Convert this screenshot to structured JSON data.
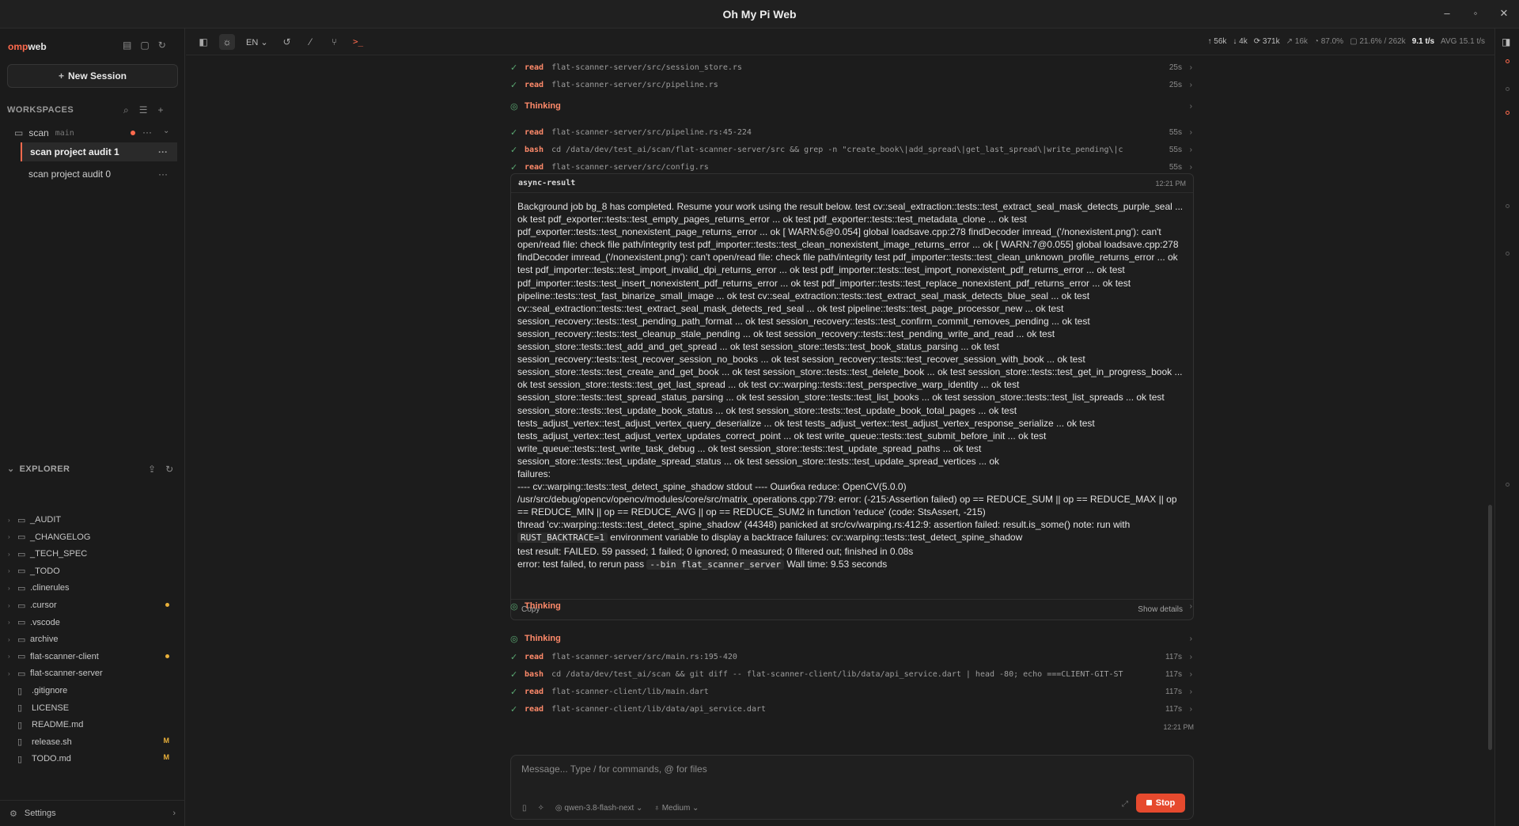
{
  "window": {
    "title": "Oh My Pi Web",
    "controls": [
      "–",
      "◦",
      "✕"
    ]
  },
  "sidebar": {
    "brand_prefix": "omp",
    "brand_suffix": "web",
    "new_session": "New Session",
    "workspaces_label": "WORKSPACES",
    "workspace": {
      "name": "scan",
      "branch": "main"
    },
    "sessions": [
      {
        "label": "scan project audit 1",
        "active": true
      },
      {
        "label": "scan project audit 0",
        "active": false
      }
    ],
    "explorer_label": "EXPLORER",
    "tree": [
      {
        "name": "_AUDIT",
        "type": "folder",
        "mark": ""
      },
      {
        "name": "_CHANGELOG",
        "type": "folder",
        "mark": ""
      },
      {
        "name": "_TECH_SPEC",
        "type": "folder",
        "mark": ""
      },
      {
        "name": "_TODO",
        "type": "folder",
        "mark": ""
      },
      {
        "name": ".clinerules",
        "type": "folder",
        "mark": ""
      },
      {
        "name": ".cursor",
        "type": "folder",
        "mark": "dot"
      },
      {
        "name": ".vscode",
        "type": "folder",
        "mark": ""
      },
      {
        "name": "archive",
        "type": "folder",
        "mark": ""
      },
      {
        "name": "flat-scanner-client",
        "type": "folder",
        "mark": "dot"
      },
      {
        "name": "flat-scanner-server",
        "type": "folder",
        "mark": ""
      },
      {
        "name": ".gitignore",
        "type": "file",
        "mark": ""
      },
      {
        "name": "LICENSE",
        "type": "file",
        "mark": ""
      },
      {
        "name": "README.md",
        "type": "file",
        "mark": ""
      },
      {
        "name": "release.sh",
        "type": "file",
        "mark": "M"
      },
      {
        "name": "TODO.md",
        "type": "file",
        "mark": "M"
      }
    ],
    "settings_label": "Settings"
  },
  "toolbar": {
    "lang": "EN",
    "stats": {
      "up": "56k",
      "down": "4k",
      "cache": "371k",
      "ratio": "16k",
      "cache_pct": "87.0%",
      "context": "21.6% / 262k",
      "speed": "9.1 t/s",
      "avg": "AVG 15.1 t/s"
    }
  },
  "chat": {
    "tools_top": [
      {
        "kind": "tool",
        "verb": "read",
        "arg": "flat-scanner-server/src/session_store.rs",
        "time": "25s"
      },
      {
        "kind": "tool",
        "verb": "read",
        "arg": "flat-scanner-server/src/pipeline.rs",
        "time": "25s"
      },
      {
        "kind": "thinking",
        "label": "Thinking"
      },
      {
        "kind": "tool",
        "verb": "read",
        "arg": "flat-scanner-server/src/pipeline.rs:45-224",
        "time": "55s"
      },
      {
        "kind": "tool",
        "verb": "bash",
        "arg": "cd /data/dev/test_ai/scan/flat-scanner-server/src && grep -n \"create_book\\|add_spread\\|get_last_spread\\|write_pending\\|c",
        "time": "55s"
      },
      {
        "kind": "tool",
        "verb": "read",
        "arg": "flat-scanner-server/src/config.rs",
        "time": "55s"
      }
    ],
    "card": {
      "name": "async-result",
      "time": "12:21 PM",
      "lines": [
        "Background job bg_8 has completed. Resume your work using the result below. test cv::seal_extraction::tests::test_extract_seal_mask_detects_purple_seal ... ok test pdf_exporter::tests::test_empty_pages_returns_error ... ok test pdf_exporter::tests::test_metadata_clone ... ok test pdf_exporter::tests::test_nonexistent_page_returns_error ... ok [ WARN:6@0.054] global loadsave.cpp:278 findDecoder imread_('/nonexistent.png'): can't open/read file: check file path/integrity test pdf_importer::tests::test_clean_nonexistent_image_returns_error ... ok [ WARN:7@0.055] global loadsave.cpp:278 findDecoder imread_('/nonexistent.png'): can't open/read file: check file path/integrity test pdf_importer::tests::test_clean_unknown_profile_returns_error ... ok test pdf_importer::tests::test_import_invalid_dpi_returns_error ... ok test pdf_importer::tests::test_import_nonexistent_pdf_returns_error ... ok test pdf_importer::tests::test_insert_nonexistent_pdf_returns_error ... ok test pdf_importer::tests::test_replace_nonexistent_pdf_returns_error ... ok test pipeline::tests::test_fast_binarize_small_image ... ok test cv::seal_extraction::tests::test_extract_seal_mask_detects_blue_seal ... ok test cv::seal_extraction::tests::test_extract_seal_mask_detects_red_seal ... ok test pipeline::tests::test_page_processor_new ... ok test session_recovery::tests::test_pending_path_format ... ok test session_recovery::tests::test_confirm_commit_removes_pending ... ok test session_recovery::tests::test_cleanup_stale_pending ... ok test session_recovery::tests::test_pending_write_and_read ... ok test session_store::tests::test_add_and_get_spread ... ok test session_store::tests::test_book_status_parsing ... ok test session_recovery::tests::test_recover_session_no_books ... ok test session_recovery::tests::test_recover_session_with_book ... ok test session_store::tests::test_create_and_get_book ... ok test session_store::tests::test_delete_book ... ok test session_store::tests::test_get_in_progress_book ... ok test session_store::tests::test_get_last_spread ... ok test cv::warping::tests::test_perspective_warp_identity ... ok test session_store::tests::test_spread_status_parsing ... ok test session_store::tests::test_list_books ... ok test session_store::tests::test_list_spreads ... ok test session_store::tests::test_update_book_status ... ok test session_store::tests::test_update_book_total_pages ... ok test tests_adjust_vertex::test_adjust_vertex_query_deserialize ... ok test tests_adjust_vertex::test_adjust_vertex_response_serialize ... ok test tests_adjust_vertex::test_adjust_vertex_updates_correct_point ... ok test write_queue::tests::test_submit_before_init ... ok test write_queue::tests::test_write_task_debug ... ok test session_store::tests::test_update_spread_paths ... ok test session_store::tests::test_update_spread_status ... ok test session_store::tests::test_update_spread_vertices ... ok",
        "failures:",
        "---- cv::warping::tests::test_detect_spine_shadow stdout ---- Ошибка reduce: OpenCV(5.0.0) /usr/src/debug/opencv/opencv/modules/core/src/matrix_operations.cpp:779: error: (-215:Assertion failed) op == REDUCE_SUM || op == REDUCE_MAX || op == REDUCE_MIN || op == REDUCE_AVG || op == REDUCE_SUM2 in function 'reduce' (code: StsAssert, -215)",
        "thread 'cv::warping::tests::test_detect_spine_shadow' (44348) panicked at src/cv/warping.rs:412:9: assertion failed: result.is_some() note: run with"
      ],
      "line_env_code": "RUST_BACKTRACE=1",
      "line_env_rest": " environment variable to display a backtrace failures: cv::warping::tests::test_detect_spine_shadow",
      "result_line": "test result: FAILED. 59 passed; 1 failed; 0 ignored; 0 measured; 0 filtered out; finished in 0.08s",
      "err_prefix": "error: test failed, to rerun pass ",
      "err_code": "--bin flat_scanner_server",
      "err_suffix": " Wall time: 9.53 seconds",
      "copy": "Copy",
      "show_details": "Show details"
    },
    "tools_bottom": [
      {
        "kind": "thinking",
        "label": "Thinking"
      },
      {
        "kind": "tool",
        "verb": "read",
        "arg": "flat-scanner-server/src/main.rs:195-420",
        "time": "117s"
      },
      {
        "kind": "tool",
        "verb": "bash",
        "arg": "cd /data/dev/test_ai/scan && git diff -- flat-scanner-client/lib/data/api_service.dart | head -80; echo ===CLIENT-GIT-ST",
        "time": "117s"
      },
      {
        "kind": "tool",
        "verb": "read",
        "arg": "flat-scanner-client/lib/main.dart",
        "time": "117s"
      },
      {
        "kind": "tool",
        "verb": "read",
        "arg": "flat-scanner-client/lib/data/api_service.dart",
        "time": "117s"
      }
    ],
    "stamp": "12:21 PM",
    "thinking_last": "Thinking"
  },
  "composer": {
    "placeholder": "Message... Type / for commands, @ for files",
    "model": "qwen-3.8-flash-next",
    "effort": "Medium",
    "stop": "Stop"
  },
  "colors": {
    "accent": "#ff6a4d",
    "stop": "#e64a2e",
    "check": "#5aa872"
  }
}
